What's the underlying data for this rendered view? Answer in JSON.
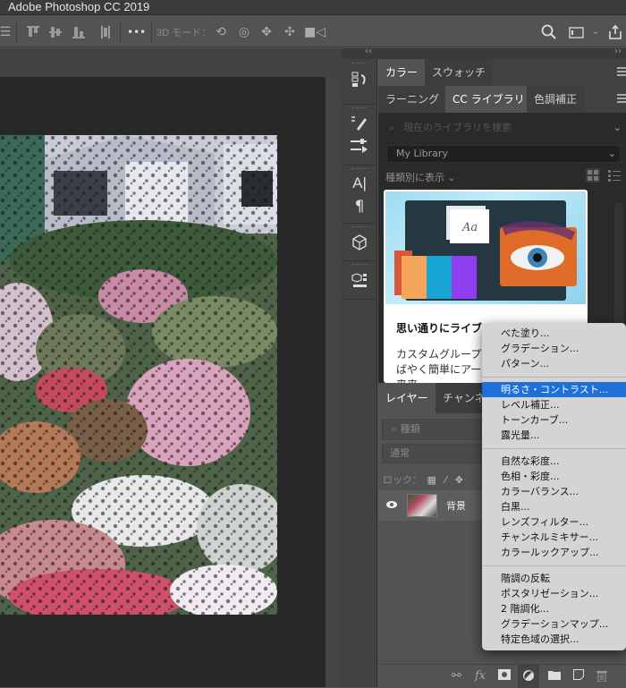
{
  "window": {
    "title": "Adobe Photoshop CC 2019"
  },
  "options_bar": {
    "three_d_mode_label": "3D モード：",
    "more_label": "•••",
    "icons": [
      "align-top-icon",
      "align-vcenter-icon",
      "align-bottom-icon",
      "distribute-icon",
      "more-icon",
      "rotate-3d-icon",
      "roll-3d-icon",
      "drag-3d-icon",
      "slide-3d-icon",
      "scale-3d-icon",
      "search-icon",
      "workspace-icon",
      "share-icon"
    ]
  },
  "panel_collapse": {
    "left": "‹‹",
    "right": "››"
  },
  "tool_strip": {
    "items": [
      "history",
      "brush-settings",
      "adjustments",
      "character",
      "paragraph",
      "3d",
      "3d-layers"
    ]
  },
  "panel_groups": {
    "top_tabs": [
      {
        "label": "カラー",
        "active": true
      },
      {
        "label": "スウォッチ",
        "active": false
      }
    ],
    "second_tabs": [
      {
        "label": "ラーニング",
        "active": false
      },
      {
        "label": "CC ライブラリ",
        "active": true
      },
      {
        "label": "色調補正",
        "active": false
      }
    ]
  },
  "libraries": {
    "search_placeholder": "現在のライブラリを検索",
    "selected_library": "My Library",
    "view_by": "種類別に表示",
    "card": {
      "swatch_label": "Aa",
      "title": "思い通りにライブ",
      "desc_line1": "カスタムグループ",
      "desc_line2": "ばやく簡単にアー",
      "desc_line3": "来来"
    },
    "colors": {
      "swatch1": "#f6a65a",
      "swatch2": "#18a5d4",
      "swatch3": "#8e3ef0",
      "swatch_back": "#d9563a"
    }
  },
  "layers": {
    "tabs": [
      {
        "label": "レイヤー",
        "active": true
      },
      {
        "label": "チャンネ",
        "active": false
      }
    ],
    "filter_placeholder": "種類",
    "blend_mode": "通常",
    "lock_label": "ロック：",
    "rows": [
      {
        "name": "背景",
        "visible": true
      }
    ]
  },
  "context_menu": {
    "groups": [
      [
        "べた塗り...",
        "グラデーション...",
        "パターン..."
      ],
      [
        "明るさ・コントラスト...",
        "レベル補正...",
        "トーンカーブ...",
        "露光量..."
      ],
      [
        "自然な彩度...",
        "色相・彩度...",
        "カラーバランス...",
        "白黒...",
        "レンズフィルター...",
        "チャンネルミキサー...",
        "カラールックアップ..."
      ],
      [
        "階調の反転",
        "ポスタリゼーション...",
        "2 階調化...",
        "グラデーションマップ...",
        "特定色域の選択..."
      ]
    ],
    "highlighted": "明るさ・コントラスト...",
    "highlight_color": "#1f6fd8"
  }
}
